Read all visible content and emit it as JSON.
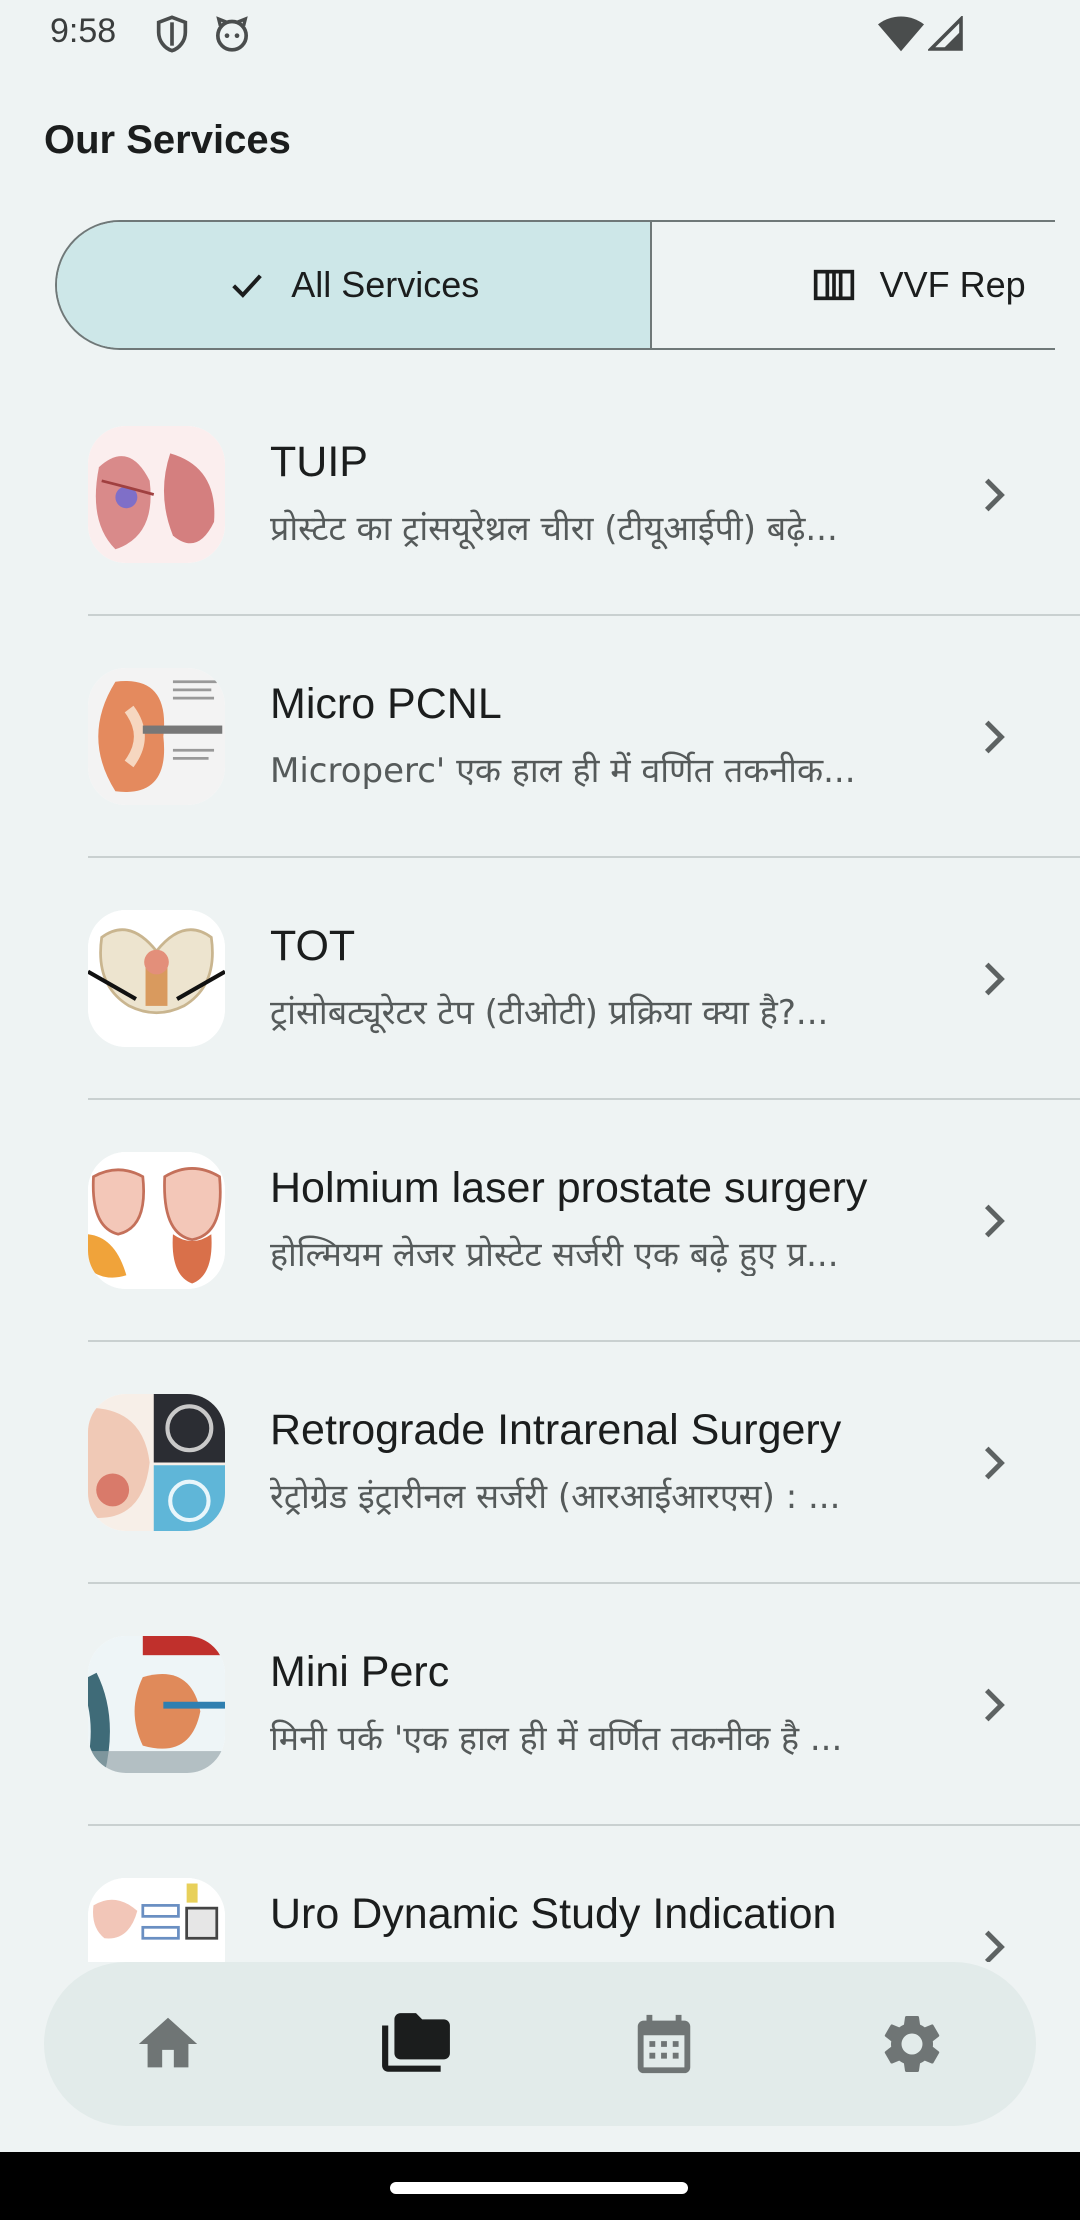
{
  "status_bar": {
    "time": "9:58"
  },
  "page": {
    "title": "Our Services"
  },
  "filters": [
    {
      "label": "All Services",
      "selected": true,
      "icon": "check-icon"
    },
    {
      "label": "VVF Rep",
      "selected": false,
      "icon": "view-column-icon"
    }
  ],
  "services": [
    {
      "title": "TUIP",
      "subtitle": "प्रोस्टेट का ट्रांसयूरेथ्रल चीरा (टीयूआईपी) बढ़े..."
    },
    {
      "title": "Micro PCNL",
      "subtitle": "Microperc' एक हाल ही में वर्णित तकनीक..."
    },
    {
      "title": "TOT",
      "subtitle": "ट्रांसोबट्यूरेटर टेप (टीओटी) प्रक्रिया क्या है?..."
    },
    {
      "title": "Holmium laser prostate surgery",
      "subtitle": "होल्मियम लेजर प्रोस्टेट सर्जरी एक बढ़े हुए प्र..."
    },
    {
      "title": "Retrograde Intrarenal Surgery",
      "subtitle": "रेट्रोग्रेड इंट्रारीनल सर्जरी (आरआईआरएस) : ..."
    },
    {
      "title": "Mini Perc",
      "subtitle": "मिनी पर्क 'एक हाल ही में वर्णित तकनीक है ..."
    },
    {
      "title": "Uro Dynamic Study Indication",
      "subtitle": ""
    }
  ],
  "bottom_nav": [
    {
      "icon": "home-icon",
      "selected": false
    },
    {
      "icon": "folder-copy-icon",
      "selected": true
    },
    {
      "icon": "calendar-icon",
      "selected": false
    },
    {
      "icon": "settings-icon",
      "selected": false
    }
  ],
  "colors": {
    "background": "#eef3f3",
    "selected_chip": "#cde7e8",
    "nav_bar": "#e2ebea",
    "icon_inactive": "#6f7575",
    "icon_active": "#1b1d1d"
  }
}
